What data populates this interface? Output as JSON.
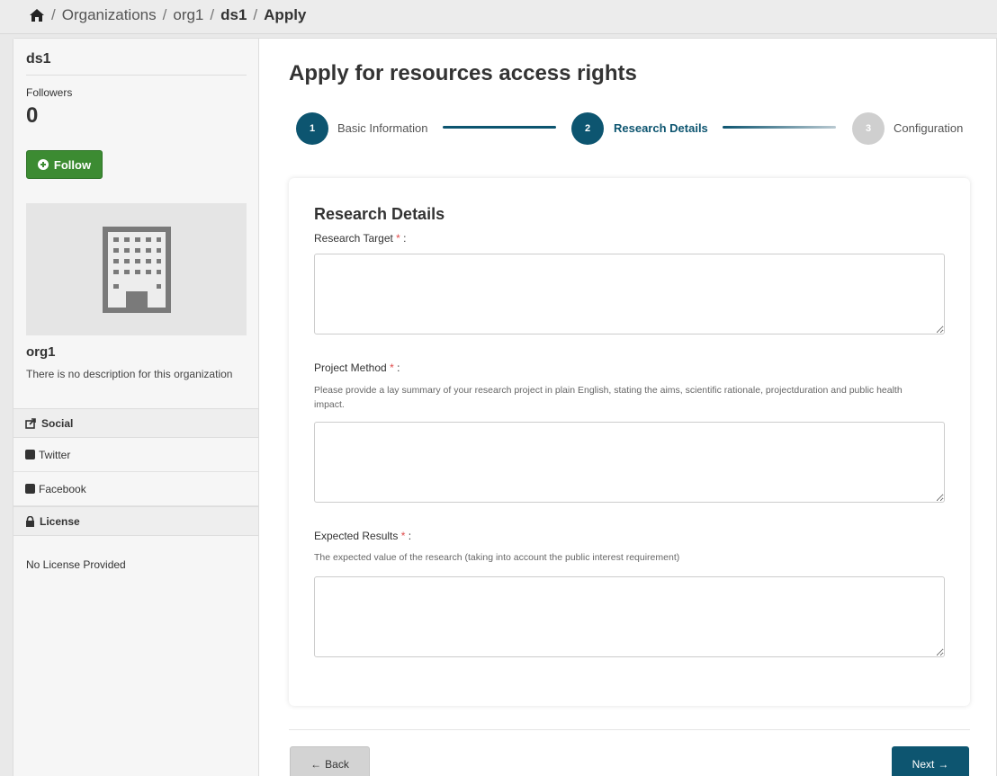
{
  "breadcrumb": {
    "home_icon": "home-icon",
    "items": [
      "Organizations",
      "org1",
      "ds1",
      "Apply"
    ],
    "separator": "/"
  },
  "sidebar": {
    "title": "ds1",
    "followers_label": "Followers",
    "followers_count": "0",
    "follow_button": "Follow",
    "org_image_icon": "building-icon",
    "org_name": "org1",
    "org_description": "There is no description for this organization",
    "social_heading": "Social",
    "social_links": [
      "Twitter",
      "Facebook"
    ],
    "license_heading": "License",
    "license_text": "No License Provided"
  },
  "main": {
    "title": "Apply for resources access rights",
    "steps": [
      {
        "number": "1",
        "label": "Basic Information",
        "state": "done"
      },
      {
        "number": "2",
        "label": "Research Details",
        "state": "active"
      },
      {
        "number": "3",
        "label": "Configuration",
        "state": "pending"
      }
    ],
    "card": {
      "title": "Research Details",
      "fields": [
        {
          "label": "Research Target",
          "required_mark": "*",
          "suffix": " :",
          "help": "",
          "value": ""
        },
        {
          "label": "Project Method",
          "required_mark": "*",
          "suffix": " :",
          "help": "Please provide a lay summary of your research project in plain English, stating the aims, scientific rationale, projectduration and public health impact.",
          "value": ""
        },
        {
          "label": "Expected Results",
          "required_mark": "*",
          "suffix": " :",
          "help": "The expected value of the research (taking into account the public interest requirement)",
          "value": ""
        }
      ]
    },
    "back_button": "Back",
    "next_button": "Next"
  },
  "colors": {
    "primary": "#0d5570",
    "follow_green": "#3c8b32",
    "required_red": "#e04b4b",
    "step_pending": "#cfcfcf"
  }
}
